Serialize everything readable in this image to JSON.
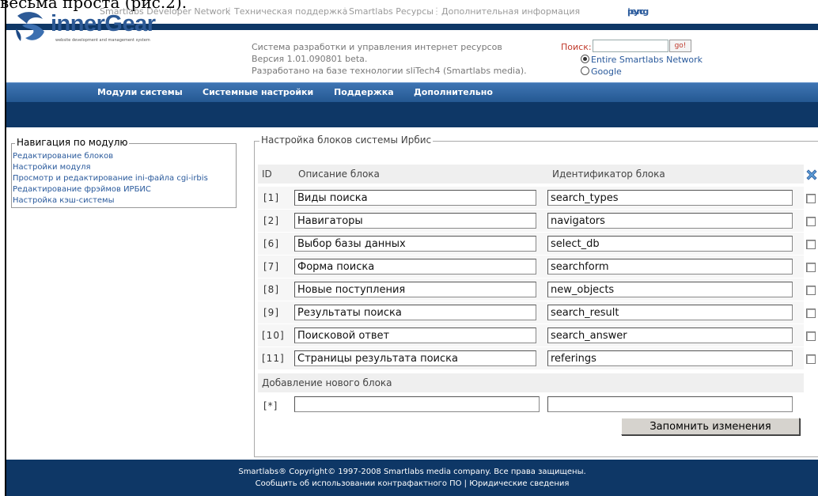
{
  "doc": {
    "caption": "весьма проста (рис.2)."
  },
  "top_links": {
    "items": [
      "Smartlabs Developer Network",
      "Техническая поддержка",
      "Smartlabs Ресурсы",
      "Дополнительная информация"
    ],
    "lang_ru": "рус",
    "lang_sep": "|",
    "lang_en": "eng"
  },
  "header": {
    "logo_text": "innerGear",
    "logo_tagline": "website development and management system",
    "info_line1": "Система разработки и управления интернет ресурсов",
    "info_line2": "Версия 1.01.090801 beta.",
    "info_line3": "Разработано на базе технологии sliTech4 (Smartlabs media).",
    "search_label": "Поиск:",
    "search_value": "",
    "search_button": "go!",
    "radio_network": "Entire Smartlabs Network",
    "radio_google": "Google",
    "selected_radio": "network"
  },
  "menu": [
    "Модули системы",
    "Системные настройки",
    "Поддержка",
    "Дополнительно"
  ],
  "nav": {
    "legend": "Навигация по модулю",
    "items": [
      "Редактирование блоков",
      "Настройки модуля",
      "Просмотр и редактирование ini-файла cgi-irbis",
      "Редактирование фрэймов ИРБИС",
      "Настройка кэш-системы"
    ]
  },
  "main": {
    "legend": "Настройка блоков системы Ирбис",
    "col_id": "ID",
    "col_desc": "Описание блока",
    "col_key": "Идентификатор блока",
    "rows": [
      {
        "id": "[1]",
        "desc": "Виды поиска",
        "key": "search_types"
      },
      {
        "id": "[2]",
        "desc": "Навигаторы",
        "key": "navigators"
      },
      {
        "id": "[6]",
        "desc": "Выбор базы данных",
        "key": "select_db"
      },
      {
        "id": "[7]",
        "desc": "Форма поиска",
        "key": "searchform"
      },
      {
        "id": "[8]",
        "desc": "Новые поступления",
        "key": "new_objects"
      },
      {
        "id": "[9]",
        "desc": "Результаты поиска",
        "key": "search_result"
      },
      {
        "id": "[10]",
        "desc": "Поисковой ответ",
        "key": "search_answer"
      },
      {
        "id": "[11]",
        "desc": "Страницы результата поиска",
        "key": "referings"
      }
    ],
    "add_label": "Добавление нового блока",
    "new_row": {
      "id": "[*]",
      "desc": "",
      "key": ""
    },
    "save_button": "Запомнить изменения"
  },
  "footer": {
    "line1": "Smartlabs® Copyright© 1997-2008 Smartlabs media company. Все права защищены.",
    "line2": "Сообщить об использовании контрафактного ПО | Юридические сведения"
  },
  "colors": {
    "brand_blue": "#2d5a96",
    "dark_navy": "#0e3766",
    "menu_blue": "#245892"
  }
}
